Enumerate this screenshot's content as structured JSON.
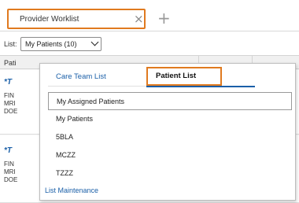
{
  "tabs": {
    "active_label": "Provider Worklist",
    "close_glyph": "×",
    "add_glyph": "+"
  },
  "list_selector": {
    "label": "List:",
    "selected_value": "My Patients (10)"
  },
  "worklist": {
    "header_text": "Pati",
    "cards": [
      {
        "name": "*T",
        "lines": [
          "FIN",
          "MRI",
          "DOE"
        ]
      },
      {
        "name": "*T",
        "lines": [
          "FIN",
          "MRI",
          "DOE"
        ]
      }
    ]
  },
  "dropdown": {
    "tabs": {
      "care_team": "Care Team List",
      "patient_list": "Patient List"
    },
    "items": [
      "My Assigned Patients",
      "My Patients",
      "5BLA",
      "MCZZ",
      "TZZZ"
    ],
    "footer_link": "List Maintenance"
  },
  "colors": {
    "highlight_orange": "#e07a1f",
    "link_blue": "#1a5fa8"
  }
}
